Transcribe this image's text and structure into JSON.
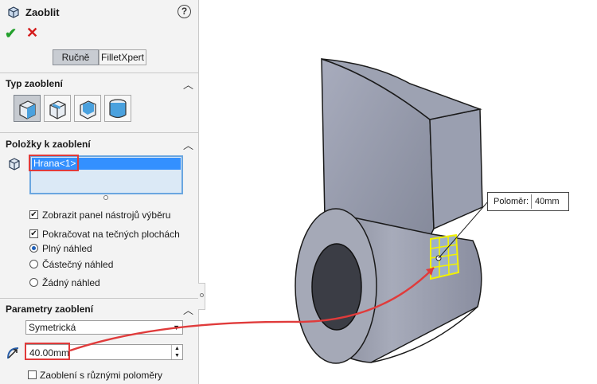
{
  "header": {
    "title": "Zaoblit",
    "help_icon": "?",
    "ok_icon": "✔",
    "cancel_icon": "✕"
  },
  "mode_tabs": [
    {
      "label": "Ručně",
      "selected": true
    },
    {
      "label": "FilletXpert",
      "selected": false
    }
  ],
  "fillet_type": {
    "title": "Typ zaoblení",
    "buttons": [
      "constant-size-fillet",
      "variable-size-fillet",
      "face-fillet",
      "full-round-fillet"
    ]
  },
  "items": {
    "title": "Položky k zaoblení",
    "list": [
      "Hrana<1>"
    ],
    "options": [
      {
        "type": "checkbox",
        "label": "Zobrazit panel nástrojů výběru",
        "checked": true
      },
      {
        "type": "checkbox",
        "label": "Pokračovat na tečných plochách",
        "checked": true
      },
      {
        "type": "radio",
        "label": "Plný náhled",
        "checked": true
      },
      {
        "type": "radio",
        "label": "Částečný náhled",
        "checked": false
      },
      {
        "type": "radio",
        "label": "Žádný náhled",
        "checked": false
      }
    ]
  },
  "params": {
    "title": "Parametry zaoblení",
    "method": "Symetrická",
    "radius": "40.00mm",
    "multi_radius": {
      "label": "Zaoblení s různými poloměry",
      "checked": false
    }
  },
  "callout": {
    "label": "Poloměr:",
    "value": "40mm"
  },
  "colors": {
    "accent_red": "#e03b3b",
    "selection_blue": "#3390ff",
    "preview_yellow": "#f2f200",
    "model_grey": "#8e93a2"
  }
}
